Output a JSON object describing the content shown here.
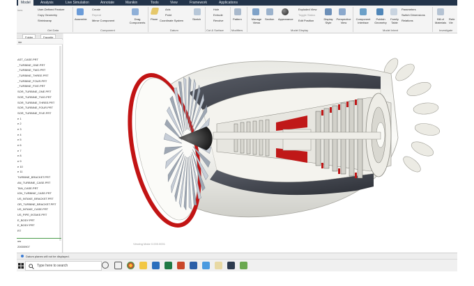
{
  "menu": {
    "tabs": [
      "Model",
      "Analysis",
      "Live Simulation",
      "Annotate",
      "Manikin",
      "Tools",
      "View",
      "Framework",
      "Applications"
    ]
  },
  "ribbon": {
    "buttons": {
      "user_defined_feature": "User-Defined Feature",
      "copy_geometry": "Copy Geometry",
      "shrinkwrap": "Shrinkwrap",
      "assemble": "Assemble",
      "create": "Create",
      "repeat": "Repeat",
      "mirror_component": "Mirror Component",
      "drag_components": "Drag Components",
      "plane": "Plane",
      "axis": "Axis",
      "point": "Point",
      "coordinate_system": "Coordinate System",
      "sketch": "Sketch",
      "hole": "Hole",
      "extrude": "Extrude",
      "revolve": "Revolve",
      "pattern": "Pattern",
      "manage_views": "Manage Views",
      "section": "Section",
      "appearance": "Appearance",
      "exploded_view": "Exploded View",
      "toggle_status": "Toggle Status",
      "edit_position": "Edit Position",
      "display_style": "Display Style",
      "perspective_view": "Perspective View",
      "component_interface": "Component Interface",
      "publish_geometry": "Publish Geometry",
      "family_table": "Family Table",
      "parameters": "Parameters",
      "switch_dimensions": "Switch Dimensions",
      "relations": "Relations",
      "bill_of_materials": "Bill of Materials",
      "reference_viewer": "Refe Vie"
    },
    "groups": [
      "Get Data",
      "Component",
      "Datum",
      "Cut & Surface",
      "Modifiers",
      "Model Display",
      "Model Intent",
      "Investigate"
    ],
    "operations_label": "ions"
  },
  "left_panel": {
    "tabs": [
      "Folder",
      "Favorite"
    ],
    "show_label": "ide",
    "tree_items": [
      "AST_CASE.PRT",
      "_TURBINE_ONE.PRT",
      "_TURBINE_TWO.PRT",
      "_TURBINE_THREE.PRT",
      "_TURBINE_FOUR.PRT",
      "_TURBINE_FIVE.PRT",
      "SOR_TURBINE_ONE.PRT",
      "SOR_TURBINE_TWO.PRT",
      "SOR_TURBINE_THREE.PRT",
      "SOR_TURBINE_FOUR.PRT",
      "SOR_TURBINE_FIVE.PRT",
      "e 1",
      "e 2",
      "e 3",
      "e 4",
      "e 5",
      "e 6",
      "e 7",
      "e 8",
      "e 9",
      "e 10",
      "e 11",
      "TURBINE_BRACKET.PRT",
      "AN_TURBINE_CASE.PRT",
      "TAN_CASE.PRT",
      "ION_TURBINE_CASE.PRT",
      "US_INTAKE_BRACKET.PRT",
      "OR_TURBINE_BRACKET.PRT",
      "US_INTAKE_CASE.PRT",
      "US_PIPE_INTAKE.PRT",
      "E_BODY.PRT",
      "E_BODY.PRT",
      "RT",
      "",
      "ow",
      "20000907"
    ]
  },
  "viewport": {
    "watermark": "Viewing Make 0.000.0001"
  },
  "status": {
    "message": "Datum planes will not be displayed."
  },
  "taskbar": {
    "search_placeholder": "Type here to search"
  }
}
